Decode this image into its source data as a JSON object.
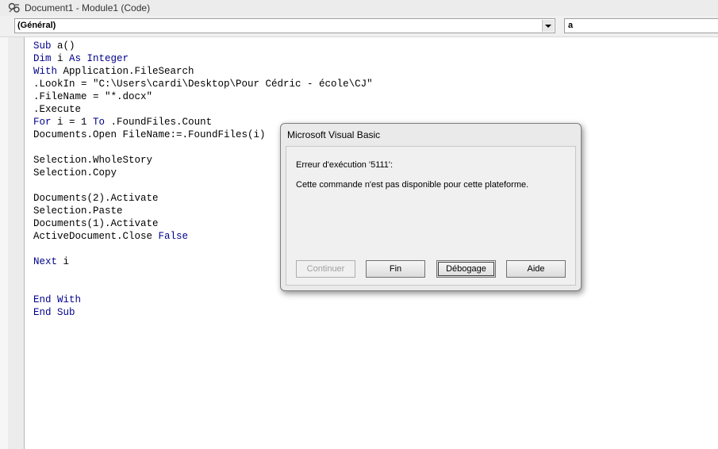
{
  "window": {
    "title": "Document1 - Module1 (Code)",
    "icon": "vba-module-icon"
  },
  "combos": {
    "object": "(Général)",
    "procedure": "a"
  },
  "code_lines": [
    [
      {
        "t": "Sub ",
        "k": 1
      },
      {
        "t": "a()",
        "k": 0
      }
    ],
    [
      {
        "t": "Dim ",
        "k": 1
      },
      {
        "t": "i ",
        "k": 0
      },
      {
        "t": "As ",
        "k": 1
      },
      {
        "t": "Integer",
        "k": 1
      }
    ],
    [
      {
        "t": "With ",
        "k": 1
      },
      {
        "t": "Application.FileSearch",
        "k": 0
      }
    ],
    [
      {
        "t": ".LookIn = \"C:\\Users\\cardi\\Desktop\\Pour Cédric - école\\CJ\"",
        "k": 0
      }
    ],
    [
      {
        "t": ".FileName = \"*.docx\"",
        "k": 0
      }
    ],
    [
      {
        "t": ".Execute",
        "k": 0
      }
    ],
    [
      {
        "t": "For ",
        "k": 1
      },
      {
        "t": "i = 1 ",
        "k": 0
      },
      {
        "t": "To ",
        "k": 1
      },
      {
        "t": ".FoundFiles.Count",
        "k": 0
      }
    ],
    [
      {
        "t": "Documents.Open FileName:=.FoundFiles(i)",
        "k": 0
      }
    ],
    [],
    [
      {
        "t": "Selection.WholeStory",
        "k": 0
      }
    ],
    [
      {
        "t": "Selection.Copy",
        "k": 0
      }
    ],
    [],
    [
      {
        "t": "Documents(2).Activate",
        "k": 0
      }
    ],
    [
      {
        "t": "Selection.Paste",
        "k": 0
      }
    ],
    [
      {
        "t": "Documents(1).Activate",
        "k": 0
      }
    ],
    [
      {
        "t": "ActiveDocument.Close ",
        "k": 0
      },
      {
        "t": "False",
        "k": 1
      }
    ],
    [],
    [
      {
        "t": "Next ",
        "k": 1
      },
      {
        "t": "i",
        "k": 0
      }
    ],
    [],
    [],
    [
      {
        "t": "End With",
        "k": 1
      }
    ],
    [
      {
        "t": "End Sub",
        "k": 1
      }
    ]
  ],
  "colors": {
    "keyword": "#00008b",
    "identifier": "#000000"
  },
  "dialog": {
    "title": "Microsoft Visual Basic",
    "error_label": "Erreur d'exécution '5111':",
    "error_message": "Cette commande n'est pas disponible pour cette plateforme.",
    "buttons": {
      "continue": "Continuer",
      "end": "Fin",
      "debug": "Débogage",
      "help": "Aide"
    }
  }
}
